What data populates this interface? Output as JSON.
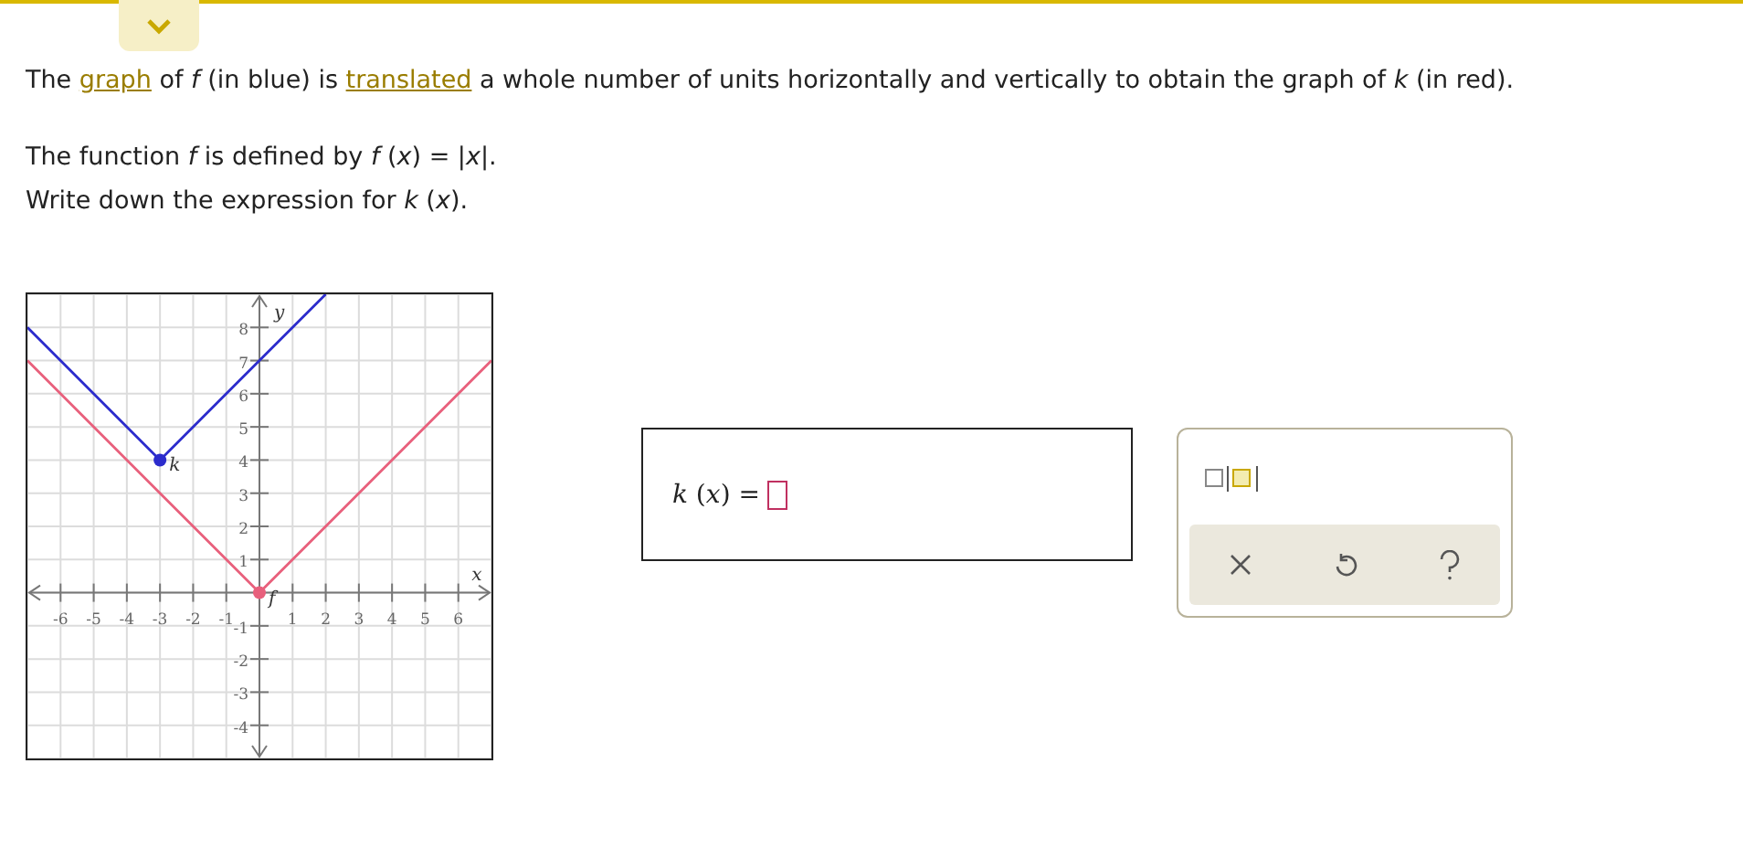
{
  "question": {
    "intro": [
      {
        "kind": "text",
        "text": "The "
      },
      {
        "kind": "link",
        "text": "graph"
      },
      {
        "kind": "text",
        "text": " of *f* (in blue) is "
      },
      {
        "kind": "link",
        "text": "translated"
      },
      {
        "kind": "text",
        "text": " a whole number of units horizontally and vertically to obtain the graph of *k* (in red)."
      }
    ],
    "definition": "The function *f* is defined by *f* (*x*) = |*x*|.",
    "instruction": "Write down the expression for *k* (*x*)."
  },
  "graph": {
    "chart_data": {
      "type": "line",
      "xlabel": "x",
      "ylabel": "y",
      "x": [
        -7,
        -3,
        0,
        2,
        7
      ],
      "series": [
        {
          "name": "k",
          "color": "#2c2ccc",
          "values": [
            8,
            4,
            7,
            9,
            null
          ]
        },
        {
          "name": "f",
          "color": "#e8607c",
          "values": [
            7,
            3,
            0,
            2,
            7
          ]
        }
      ],
      "xlim": [
        -7,
        7
      ],
      "ylim": [
        -5,
        9
      ],
      "xticks": [
        -6,
        -5,
        -4,
        -3,
        -2,
        -1,
        1,
        2,
        3,
        4,
        5,
        6
      ],
      "yticks": [
        -4,
        -3,
        -2,
        -1,
        1,
        2,
        3,
        4,
        5,
        6,
        7,
        8
      ],
      "grid": true
    }
  },
  "answer": {
    "label": "*k* (*x*) ="
  }
}
